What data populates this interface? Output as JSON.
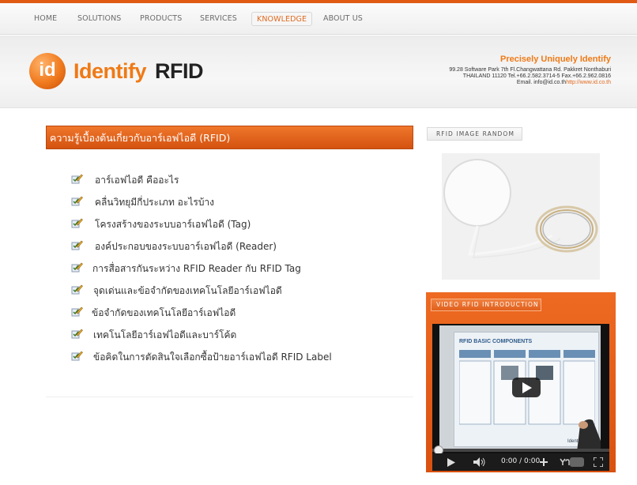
{
  "nav": {
    "items": [
      {
        "label": "HOME",
        "active": false
      },
      {
        "label": "SOLUTIONS",
        "active": false
      },
      {
        "label": "PRODUCTS",
        "active": false
      },
      {
        "label": "SERVICES",
        "active": false
      },
      {
        "label": "KNOWLEDGE",
        "active": true
      },
      {
        "label": "ABOUT US",
        "active": false
      }
    ]
  },
  "header": {
    "logo_mark": "id",
    "logo_text_a": "Identify",
    "logo_text_b": "RFID",
    "tagline": "Precisely Uniquely Identify",
    "address_lines": [
      "99.28 Software Park 7th Fl.Changwattana Rd. Pakkret Nonthaburi",
      "THAILAND 11120 Tel.+66.2.582.3714-5 Fax.+66.2.962.0816"
    ],
    "email_label": "Email. info@id.co.th",
    "website": "http://www.id.co.th"
  },
  "main": {
    "section_title": "ความรู้เบื้องต้นเกี่ยวกับอาร์เอฟไอดี (RFID)",
    "items": [
      {
        "label": "อาร์เอฟไอดี คืออะไร"
      },
      {
        "label": "คลื่นวิทยุมีกี่ประเภท อะไรบ้าง"
      },
      {
        "label": "โครงสร้างของระบบอาร์เอฟไอดี (Tag)"
      },
      {
        "label": "องค์ประกอบของระบบอาร์เอฟไอดี (Reader)"
      },
      {
        "label": "การสื่อสารกันระหว่าง RFID Reader กับ RFID Tag"
      },
      {
        "label": "จุดเด่นและข้อจำกัดของเทคโนโลยีอาร์เอฟไอดี"
      },
      {
        "label": "ข้อจำกัดของเทคโนโลยีอาร์เอฟไอดี"
      },
      {
        "label": "เทคโนโลยีอาร์เอฟไอดีและบาร์โค้ด"
      },
      {
        "label": "ข้อคิดในการตัดสินใจเลือกซื้อป้ายอาร์เอฟไอดี RFID Label"
      }
    ]
  },
  "sidebar": {
    "image_tab": "RFID IMAGE RANDOM",
    "video_tab": "VIDEO RFID INTRODUCTION",
    "video": {
      "slide_title": "RFID BASIC COMPONENTS",
      "time": "0:00 / 0:00",
      "brand_watermark": "Identify RFID"
    }
  },
  "colors": {
    "accent": "#e05a14",
    "nav_active": "#e06a20",
    "logo_orange": "#ef7a16"
  }
}
